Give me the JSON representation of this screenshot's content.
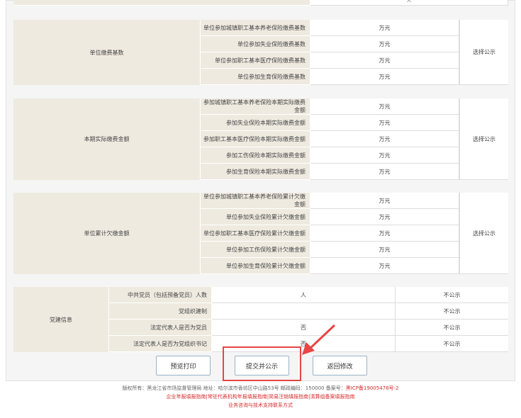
{
  "top_partial": {
    "value": "人"
  },
  "section1": {
    "group": "单位缴费基数",
    "rows": [
      {
        "label": "单位参加城镇职工基本养老保险缴费基数",
        "unit": "万元"
      },
      {
        "label": "单位参加失业保险缴费基数",
        "unit": "万元"
      },
      {
        "label": "单位参加职工基本医疗保险缴费基数",
        "unit": "万元"
      },
      {
        "label": "单位参加生育保险缴费基数",
        "unit": "万元"
      }
    ],
    "publish": "选择公示"
  },
  "section2": {
    "group": "本期实际缴费金额",
    "rows": [
      {
        "label": "参加城镇职工基本养老保险本期实际缴费金额",
        "unit": "万元"
      },
      {
        "label": "参加失业保险本期实际缴费金额",
        "unit": "万元"
      },
      {
        "label": "参加职工基本医疗保险本期实际缴费金额",
        "unit": "万元"
      },
      {
        "label": "参加工伤保险本期实际缴费金额",
        "unit": "万元"
      },
      {
        "label": "参加生育保险本期实际缴费金额",
        "unit": "万元"
      }
    ],
    "publish": "选择公示"
  },
  "section3": {
    "group": "单位累计欠缴金额",
    "rows": [
      {
        "label": "单位参加城镇职工基本养老保险累计欠缴金额",
        "unit": "万元"
      },
      {
        "label": "单位参加失业保险累计欠缴金额",
        "unit": "万元"
      },
      {
        "label": "单位参加职工基本医疗保险累计欠缴金额",
        "unit": "万元"
      },
      {
        "label": "单位参加工伤保险累计欠缴金额",
        "unit": "万元"
      },
      {
        "label": "单位参加生育保险累计欠缴金额",
        "unit": "万元"
      }
    ],
    "publish": "选择公示"
  },
  "section4": {
    "group": "党建信息",
    "rows": [
      {
        "label": "中共党员（包括预备党员）人数",
        "value": "人",
        "publish": "不公示"
      },
      {
        "label": "党组织建制",
        "value": "",
        "publish": "不公示"
      },
      {
        "label": "法定代表人是否为党员",
        "value": "否",
        "publish": "不公示"
      },
      {
        "label": "法定代表人是否为党组织书记",
        "value": "否",
        "publish": "不公示"
      }
    ]
  },
  "buttons": {
    "preview": "预览打印",
    "submit": "提交并公示",
    "back": "返回修改"
  },
  "footer": {
    "line1": "版权所有：黑龙江省市场监督管理局 地址：哈尔滨市香坊区中山路53号 邮政编码：150000 备案号：",
    "icp": "黑ICP备19005478号-2",
    "line2": "企业年报填报指南|常驻代表机构年报填报指南|简易注销填报指南|清算组备案填报指南",
    "line3": "业务咨询与技术支持联系方式"
  },
  "colors": {
    "label_bg": "#efeae0",
    "highlight": "#e94545",
    "link_red": "#d62b2b"
  }
}
